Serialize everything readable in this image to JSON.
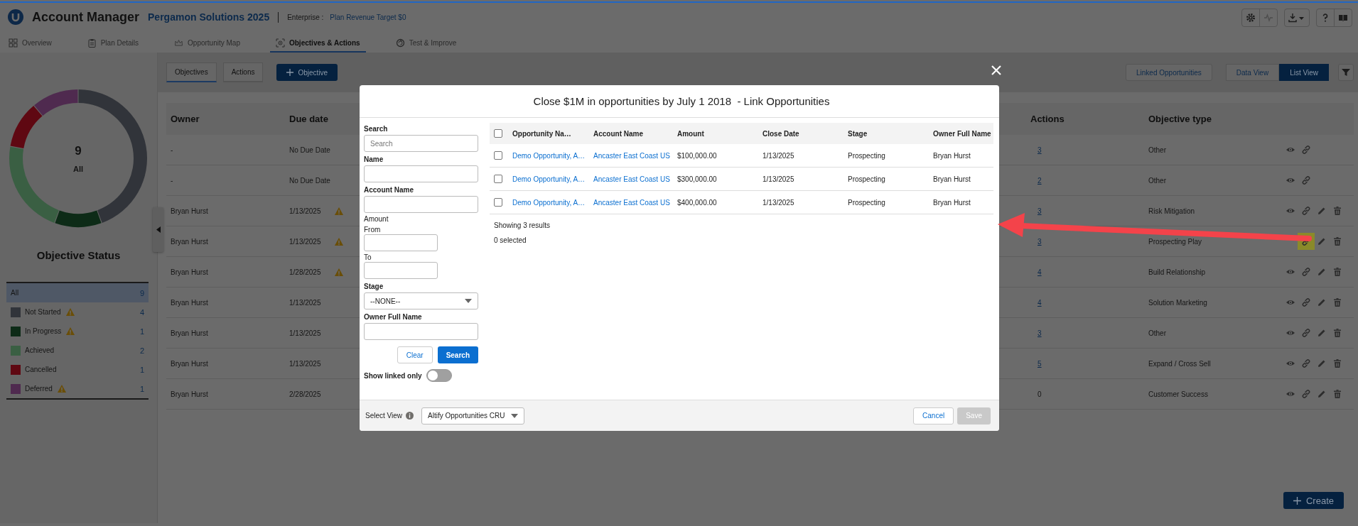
{
  "app": {
    "title": "Account Manager",
    "plan_name": "Pergamon Solutions 2025",
    "enterprise_label": "Enterprise :",
    "revenue_target": "Plan Revenue Target $0"
  },
  "nav_tabs": [
    {
      "label": "Overview",
      "selected": false
    },
    {
      "label": "Plan Details",
      "selected": false
    },
    {
      "label": "Opportunity Map",
      "selected": false
    },
    {
      "label": "Objectives & Actions",
      "selected": true
    },
    {
      "label": "Test & Improve",
      "selected": false
    }
  ],
  "objective_status": {
    "total": "9",
    "total_label": "All",
    "title": "Objective Status",
    "legend": [
      {
        "label": "All",
        "count": "9",
        "selected": true,
        "warning": false
      },
      {
        "label": "Not Started",
        "count": "4",
        "color": "#31343a",
        "selected": false,
        "warning": true
      },
      {
        "label": "In Progress",
        "count": "1",
        "color": "#0d2b17",
        "selected": false,
        "warning": true
      },
      {
        "label": "Achieved",
        "count": "2",
        "color": "#3a5f43",
        "selected": false,
        "warning": false
      },
      {
        "label": "Cancelled",
        "count": "1",
        "color": "#5f0812",
        "selected": false,
        "warning": false
      },
      {
        "label": "Deferred",
        "count": "1",
        "color": "#4f2a4f",
        "selected": false,
        "warning": true
      }
    ]
  },
  "toolbar": {
    "view_tabs": [
      {
        "label": "Objectives",
        "selected": true
      },
      {
        "label": "Actions",
        "selected": false
      }
    ],
    "add_button": "Objective",
    "linked_button": "Linked Opportunities",
    "view_toggle": [
      {
        "label": "Data View",
        "selected": false
      },
      {
        "label": "List View",
        "selected": true
      }
    ]
  },
  "table": {
    "columns": [
      "Owner",
      "Due date",
      "Actions",
      "Objective type"
    ],
    "rows": [
      {
        "owner": "-",
        "due_date": "No Due Date",
        "overdue": false,
        "actions": "3",
        "actions_link": true,
        "objective_type": "Other",
        "controls": [
          {
            "kind": "view"
          },
          {
            "kind": "link"
          }
        ],
        "link_highlighted": false
      },
      {
        "owner": "-",
        "due_date": "No Due Date",
        "overdue": false,
        "actions": "2",
        "actions_link": true,
        "objective_type": "Other",
        "controls": [
          {
            "kind": "view"
          },
          {
            "kind": "link"
          }
        ],
        "link_highlighted": false
      },
      {
        "owner": "Bryan Hurst",
        "due_date": "1/13/2025",
        "overdue": true,
        "actions": "3",
        "actions_link": true,
        "objective_type": "Risk Mitigation",
        "controls": [
          {
            "kind": "view"
          },
          {
            "kind": "link"
          },
          {
            "kind": "edit"
          },
          {
            "kind": "delete"
          }
        ],
        "link_highlighted": false
      },
      {
        "owner": "Bryan Hurst",
        "due_date": "1/13/2025",
        "overdue": true,
        "actions": "3",
        "actions_link": true,
        "objective_type": "Prospecting Play",
        "controls": [
          {
            "kind": "link"
          },
          {
            "kind": "edit"
          },
          {
            "kind": "delete"
          }
        ],
        "link_highlighted": true
      },
      {
        "owner": "Bryan Hurst",
        "due_date": "1/28/2025",
        "overdue": true,
        "actions": "4",
        "actions_link": true,
        "objective_type": "Build Relationship",
        "controls": [
          {
            "kind": "view"
          },
          {
            "kind": "link"
          },
          {
            "kind": "edit"
          },
          {
            "kind": "delete"
          }
        ],
        "link_highlighted": false
      },
      {
        "owner": "Bryan Hurst",
        "due_date": "1/13/2025",
        "overdue": false,
        "actions": "4",
        "actions_link": true,
        "objective_type": "Solution Marketing",
        "controls": [
          {
            "kind": "view"
          },
          {
            "kind": "link"
          },
          {
            "kind": "edit"
          },
          {
            "kind": "delete"
          }
        ],
        "link_highlighted": false
      },
      {
        "owner": "Bryan Hurst",
        "due_date": "1/13/2025",
        "overdue": false,
        "actions": "3",
        "actions_link": true,
        "objective_type": "Other",
        "controls": [
          {
            "kind": "view"
          },
          {
            "kind": "link"
          },
          {
            "kind": "edit"
          },
          {
            "kind": "delete"
          }
        ],
        "link_highlighted": false
      },
      {
        "owner": "Bryan Hurst",
        "due_date": "1/13/2025",
        "overdue": false,
        "actions": "5",
        "actions_link": true,
        "objective_type": "Expand / Cross Sell",
        "controls": [
          {
            "kind": "view"
          },
          {
            "kind": "link"
          },
          {
            "kind": "edit"
          },
          {
            "kind": "delete"
          }
        ],
        "link_highlighted": false
      },
      {
        "owner": "Bryan Hurst",
        "due_date": "2/28/2025",
        "overdue": false,
        "actions": "0",
        "actions_link": false,
        "objective_type": "Customer Success",
        "controls": [
          {
            "kind": "view"
          },
          {
            "kind": "link"
          },
          {
            "kind": "edit"
          },
          {
            "kind": "delete"
          }
        ],
        "link_highlighted": false
      }
    ]
  },
  "create_button": "Create",
  "modal": {
    "title": "Close $1M in opportunities by July 1 2018  - Link Opportunities",
    "filters": {
      "search": {
        "label": "Search",
        "placeholder": "Search"
      },
      "name": {
        "label": "Name"
      },
      "account_name": {
        "label": "Account Name"
      },
      "amount": {
        "label": "Amount",
        "from_label": "From",
        "to_label": "To"
      },
      "stage": {
        "label": "Stage",
        "value": "--NONE--"
      },
      "owner": {
        "label": "Owner Full Name"
      },
      "clear_button": "Clear",
      "search_button": "Search",
      "show_linked_only": {
        "label": "Show linked only",
        "on": false
      }
    },
    "results": {
      "select_all_checked": false,
      "columns": [
        "Opportunity Na…",
        "Account Name",
        "Amount",
        "Close Date",
        "Stage",
        "Owner Full Name"
      ],
      "rows": [
        {
          "checked": false,
          "cells": [
            "Demo Opportunity, A…",
            "Ancaster East Coast US",
            "$100,000.00",
            "1/13/2025",
            "Prospecting",
            "Bryan Hurst"
          ]
        },
        {
          "checked": false,
          "cells": [
            "Demo Opportunity, A…",
            "Ancaster East Coast US",
            "$300,000.00",
            "1/13/2025",
            "Prospecting",
            "Bryan Hurst"
          ]
        },
        {
          "checked": false,
          "cells": [
            "Demo Opportunity, A…",
            "Ancaster East Coast US",
            "$400,000.00",
            "1/13/2025",
            "Prospecting",
            "Bryan Hurst"
          ]
        }
      ],
      "showing": "Showing 3 results",
      "selected_count": "0 selected"
    },
    "footer": {
      "select_view_label": "Select View",
      "view_value": "Altify Opportunities CRU",
      "cancel_button": "Cancel",
      "save_button": "Save",
      "save_disabled": true
    }
  }
}
